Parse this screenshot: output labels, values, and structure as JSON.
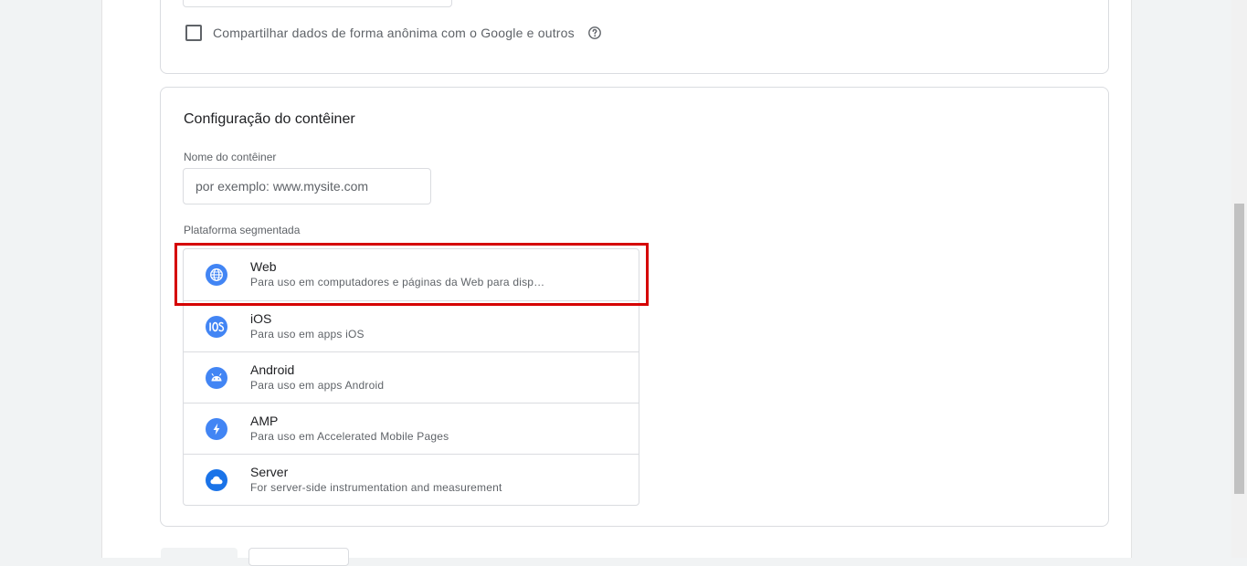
{
  "account_section": {
    "share_checkbox_label": "Compartilhar dados de forma anônima com o Google e outros",
    "share_checked": false
  },
  "container_section": {
    "title": "Configuração do contêiner",
    "name_field": {
      "label": "Nome do contêiner",
      "placeholder": "por exemplo: www.mysite.com",
      "value": ""
    },
    "platform_label": "Plataforma segmentada",
    "platforms": [
      {
        "name": "Web",
        "description": "Para uso em computadores e páginas da Web para disp…",
        "icon": "globe-icon",
        "selected": true
      },
      {
        "name": "iOS",
        "description": "Para uso em apps iOS",
        "icon": "ios-icon"
      },
      {
        "name": "Android",
        "description": "Para uso em apps Android",
        "icon": "android-icon"
      },
      {
        "name": "AMP",
        "description": "Para uso em Accelerated Mobile Pages",
        "icon": "bolt-icon"
      },
      {
        "name": "Server",
        "description": "For server-side instrumentation and measurement",
        "icon": "cloud-icon"
      }
    ]
  },
  "colors": {
    "icon_blue": "#4285f4",
    "highlight_red": "#d50000"
  }
}
